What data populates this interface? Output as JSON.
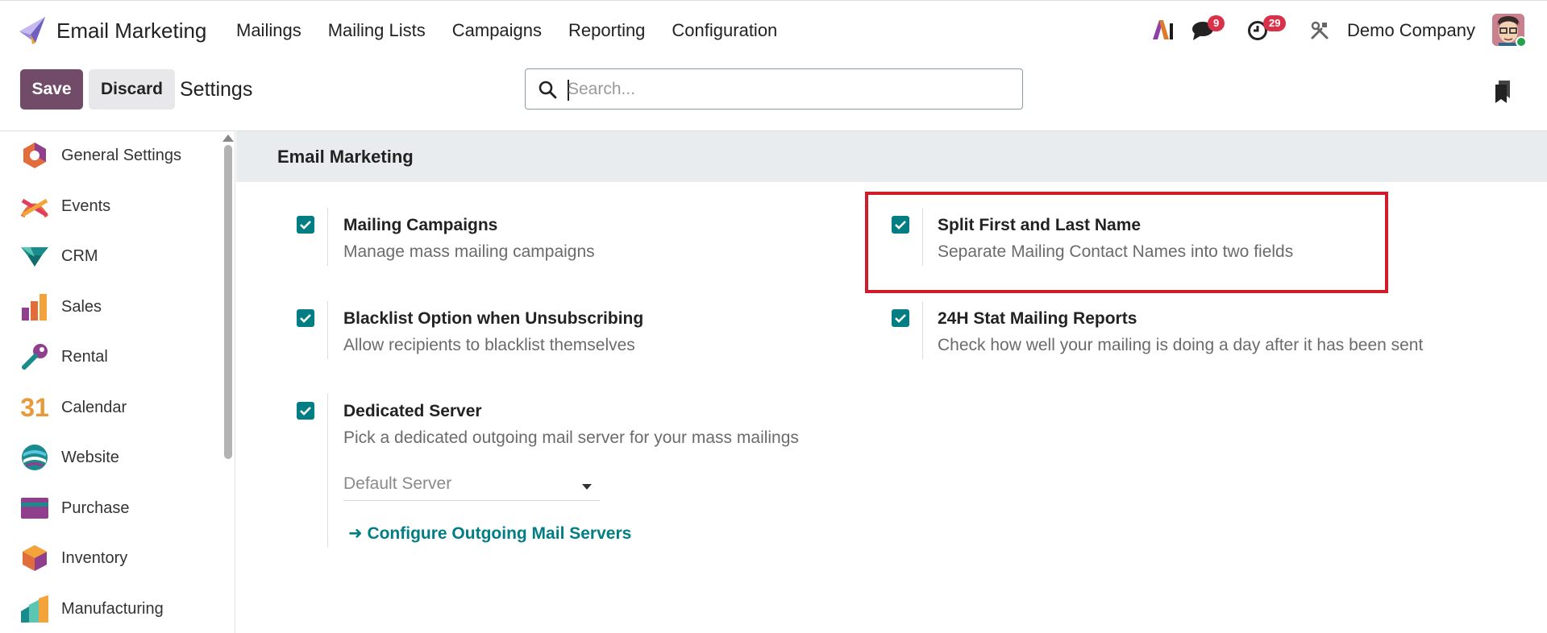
{
  "app": {
    "name": "Email Marketing"
  },
  "menu": [
    "Mailings",
    "Mailing Lists",
    "Campaigns",
    "Reporting",
    "Configuration"
  ],
  "systray": {
    "messages_count": "9",
    "activities_count": "29",
    "company": "Demo Company"
  },
  "control": {
    "save_label": "Save",
    "discard_label": "Discard",
    "breadcrumb": "Settings",
    "search_placeholder": "Search..."
  },
  "sidebar": {
    "items": [
      {
        "label": "General Settings",
        "icon": "general-settings-icon"
      },
      {
        "label": "Events",
        "icon": "events-icon"
      },
      {
        "label": "CRM",
        "icon": "crm-icon"
      },
      {
        "label": "Sales",
        "icon": "sales-icon"
      },
      {
        "label": "Rental",
        "icon": "rental-icon"
      },
      {
        "label": "Calendar",
        "icon": "calendar-icon",
        "glyph": "31"
      },
      {
        "label": "Website",
        "icon": "website-icon"
      },
      {
        "label": "Purchase",
        "icon": "purchase-icon"
      },
      {
        "label": "Inventory",
        "icon": "inventory-icon"
      },
      {
        "label": "Manufacturing",
        "icon": "manufacturing-icon"
      }
    ]
  },
  "section": {
    "title": "Email Marketing"
  },
  "settings": [
    {
      "title": "Mailing Campaigns",
      "description": "Manage mass mailing campaigns",
      "checked": true
    },
    {
      "title": "Split First and Last Name",
      "description": "Separate Mailing Contact Names into two fields",
      "checked": true
    },
    {
      "title": "Blacklist Option when Unsubscribing",
      "description": "Allow recipients to blacklist themselves",
      "checked": true
    },
    {
      "title": "24H Stat Mailing Reports",
      "description": "Check how well your mailing is doing a day after it has been sent",
      "checked": true
    },
    {
      "title": "Dedicated Server",
      "description": "Pick a dedicated outgoing mail server for your mass mailings",
      "checked": true
    }
  ],
  "dedicated_server": {
    "select_value": "Default Server",
    "configure_link": "Configure Outgoing Mail Servers"
  },
  "colors": {
    "primary": "#714b67",
    "accent": "#017e84",
    "badge": "#d9314a",
    "highlight": "#d11a2a"
  }
}
